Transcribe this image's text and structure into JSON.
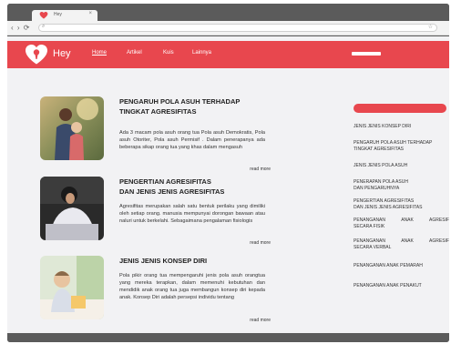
{
  "browser": {
    "tab_title": "Hey",
    "tab_close": "×",
    "nav_icons": "‹ › ⟳",
    "url_icon": "⌕",
    "star_icon": "☆"
  },
  "navbar": {
    "brand": "Hey",
    "links": [
      "Home",
      "Artikel",
      "Kuis",
      "Lainnya"
    ],
    "active": "Home",
    "accent_color": "#e8474e"
  },
  "articles": [
    {
      "title_lines": [
        "PENGARUH POLA ASUH TERHADAP",
        "TINGKAT AGRESIFITAS"
      ],
      "body": "Ada 3 macam pola asuh orang tua Pola asuh Demokratis, Pola asuh Otoriter, Pola asuh Permisif . Dalam penerapanya ada beberapa sikap orang tua yang khas dalam mengasuh",
      "read_more": "read more"
    },
    {
      "title_lines": [
        "PENGERTIAN AGRESIFITAS",
        "DAN JENIS JENIS AGRESIFITAS"
      ],
      "body": "Agresifitas merupakan salah satu bentuk perilaku yang dimiliki oleh setiap orang. manusia mempunyai dorongan bawaan atau naluri untuk berkelahi. Sebagaimana pengalaman fisiologis",
      "read_more": "read more"
    },
    {
      "title_lines": [
        "JENIS JENIS KONSEP DIRI"
      ],
      "body": "Pola pikir orang tua mempengaruhi jenis pola asuh orangtua yang mereka terapkan, dalam memenuhi kebutuhan dan mendidik anak orang tua juga membangun konsep diri kepada anak. Konsep Diri adalah persepsi individu tentang",
      "read_more": "read more"
    }
  ],
  "sidebar": {
    "items": [
      [
        "JENIS JENIS KONSEP DIRI"
      ],
      [
        "PENGARUH POLA ASUH TERHADAP",
        "TINGKAT AGRESIFITAS"
      ],
      [
        "JENIS JENIS POLA ASUH"
      ],
      [
        "PENERAPAN POLA ASUH",
        "DAN PENGARUHNYA"
      ],
      [
        "PENGERTIAN AGRESIFITAS",
        "DAN JENIS JENIS AGRESIFITAS"
      ],
      [
        "PENANGANAN ANAK AGRESIF",
        "SECARA FISIK"
      ],
      [
        "PENANGANAN ANAK AGRESIF",
        "SECARA VERBAL"
      ],
      [
        "PENANGANAN ANAK PEMARAH"
      ],
      [
        "PENANGANAN ANAK PENAKUT"
      ]
    ]
  }
}
